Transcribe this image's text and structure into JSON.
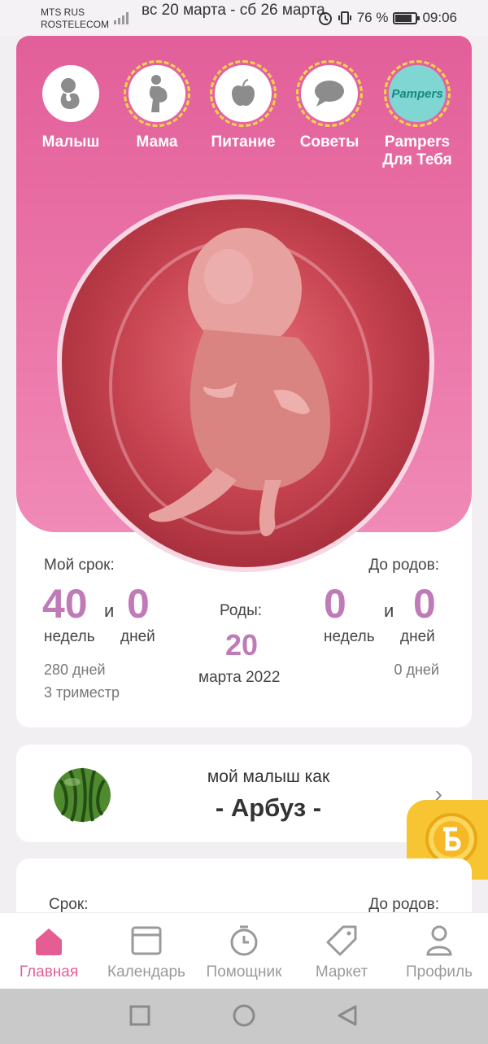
{
  "status_bar": {
    "carrier_line1": "MTS RUS",
    "carrier_line2": "ROSTELECOM",
    "date_range": "вс 20 марта - сб 26 марта",
    "battery": "76 %",
    "time": "09:06"
  },
  "top_nav": [
    {
      "label": "Малыш",
      "icon": "baby-icon"
    },
    {
      "label": "Мама",
      "icon": "mother-icon"
    },
    {
      "label": "Питание",
      "icon": "apple-icon"
    },
    {
      "label": "Советы",
      "icon": "speech-bubble-icon"
    },
    {
      "label": "Pampers\nДля Тебя",
      "icon": "pampers-logo",
      "logo_text": "Pampers"
    }
  ],
  "term": {
    "my_term_label": "Мой срок:",
    "weeks": "40",
    "and1": "и",
    "days": "0",
    "weeks_label": "недель",
    "days_label": "дней",
    "total_days": "280 дней",
    "trimester": "3 триместр"
  },
  "birth": {
    "label": "Роды:",
    "day": "20",
    "month_year": "марта 2022"
  },
  "until": {
    "label": "До родов:",
    "weeks": "0",
    "and2": "и",
    "days": "0",
    "weeks_label": "недель",
    "days_label": "дней",
    "total_days": "0 дней"
  },
  "fruit_card": {
    "subtitle": "мой малыш как",
    "name": "- Арбуз -"
  },
  "lower_card": {
    "term_label": "Срок:",
    "until_label": "До родов:"
  },
  "bottom_nav": [
    {
      "label": "Главная",
      "icon": "home-icon",
      "active": true
    },
    {
      "label": "Календарь",
      "icon": "calendar-icon"
    },
    {
      "label": "Помощник",
      "icon": "stopwatch-icon"
    },
    {
      "label": "Маркет",
      "icon": "tag-icon"
    },
    {
      "label": "Профиль",
      "icon": "profile-icon"
    }
  ],
  "colors": {
    "pink": "#e25f9a",
    "accent_text": "#c07ab8",
    "active_tab": "#e45e94",
    "coin": "#f6c531"
  }
}
